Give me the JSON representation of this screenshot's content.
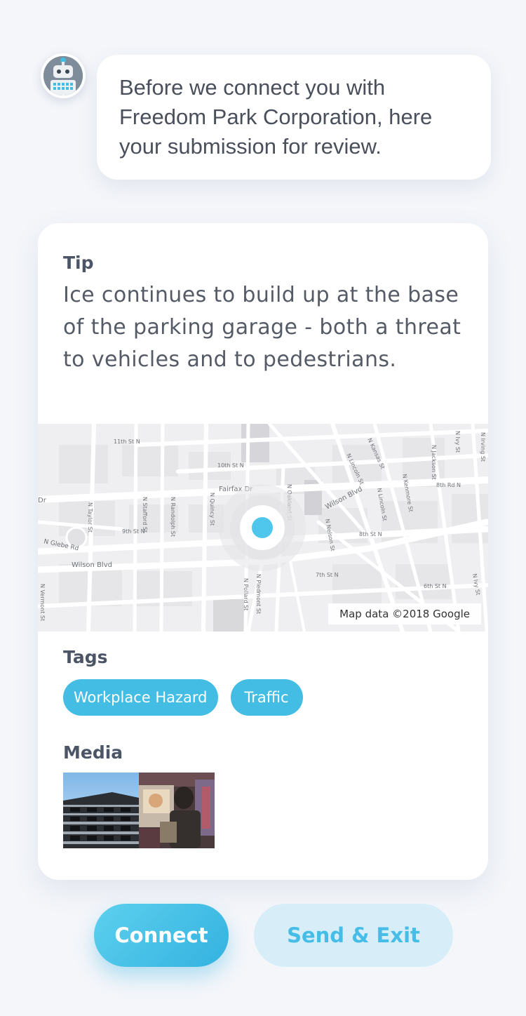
{
  "bot": {
    "avatar_icon": "robot-icon",
    "message": "Before we connect you with Freedom Park Corporation, here your submission for review."
  },
  "submission": {
    "tip_label": "Tip",
    "tip_text": "Ice continues to build up at the base of the parking garage - both a threat to vehicles and to pedestrians.",
    "map": {
      "credit": "Map data ©2018 Google",
      "street_labels": [
        "11th St N",
        "10th St N",
        "Fairfax Dr",
        "Dr",
        "N Taylor St",
        "N Stafford St",
        "N Randolph St",
        "N Quincy St",
        "9th St N",
        "Wilson Blvd",
        "N Oakland St",
        "Wilson Blvd",
        "N Lincoln St",
        "N Kansas St",
        "N Nelson St",
        "8th St N",
        "7th St N",
        "6th St N",
        "N Pollard St",
        "N Piedmont St",
        "N Vermont St",
        "N Jackson St",
        "N Ivy St",
        "N Irving St",
        "8th Rd N",
        "N Kenmore St",
        "N Lincoln St",
        "N Ivy St",
        "N Vermont St",
        "N Glebe Rd"
      ],
      "pin_color": "#4fc6ec"
    },
    "tags_label": "Tags",
    "tags": [
      "Workplace Hazard",
      "Traffic"
    ],
    "tag_color": "#43bde3",
    "media_label": "Media",
    "media": [
      "building-photo",
      "market-photo"
    ]
  },
  "actions": {
    "connect_label": "Connect",
    "send_exit_label": "Send & Exit"
  }
}
